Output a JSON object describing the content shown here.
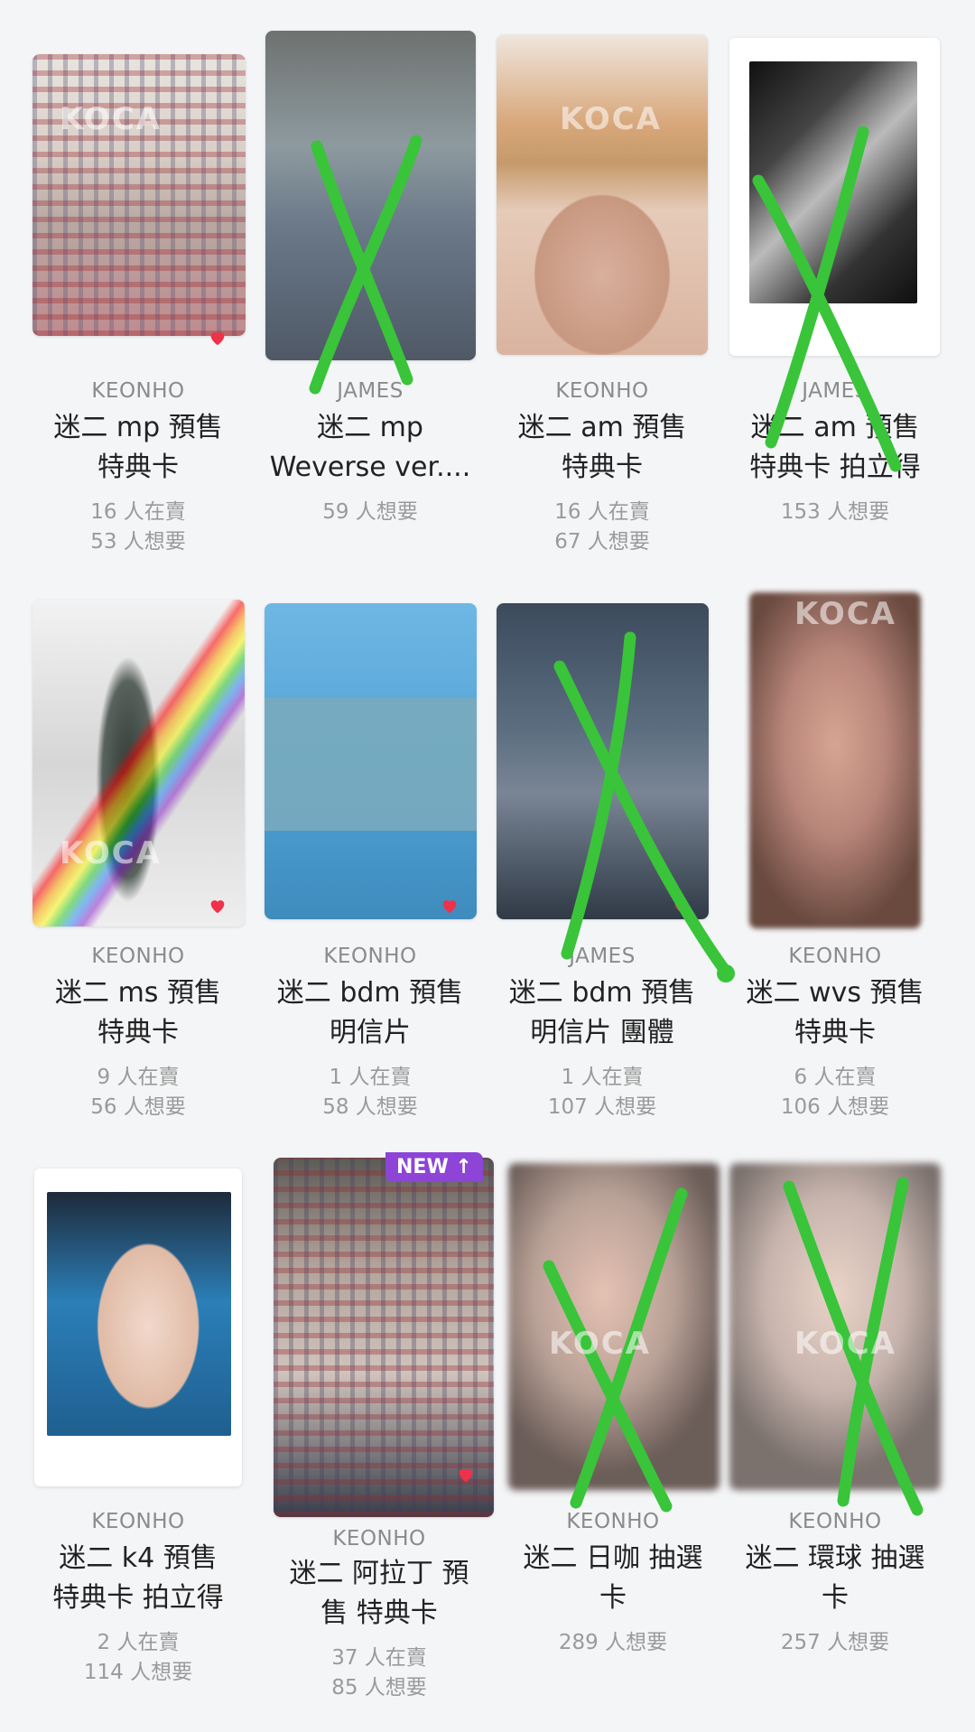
{
  "cards": [
    {
      "name": "KEONHO",
      "title": [
        "迷二 mp 預售",
        "特典卡"
      ],
      "stats": [
        "16 人在賣",
        "53 人想要"
      ],
      "favorited": true,
      "crossed": false
    },
    {
      "name": "JAMES",
      "title": [
        "迷二 mp",
        "Weverse ver...."
      ],
      "stats": [
        "59 人想要"
      ],
      "favorited": false,
      "crossed": true
    },
    {
      "name": "KEONHO",
      "title": [
        "迷二 am 預售",
        "特典卡"
      ],
      "stats": [
        "16 人在賣",
        "67 人想要"
      ],
      "favorited": false,
      "crossed": false
    },
    {
      "name": "JAMES",
      "title": [
        "迷二 am 預售",
        "特典卡 拍立得"
      ],
      "stats": [
        "153 人想要"
      ],
      "favorited": false,
      "crossed": true
    },
    {
      "name": "KEONHO",
      "title": [
        "迷二 ms 預售",
        "特典卡"
      ],
      "stats": [
        "9 人在賣",
        "56 人想要"
      ],
      "favorited": true,
      "crossed": false
    },
    {
      "name": "KEONHO",
      "title": [
        "迷二 bdm 預售",
        "明信片"
      ],
      "stats": [
        "1 人在賣",
        "58 人想要"
      ],
      "favorited": true,
      "crossed": false
    },
    {
      "name": "JAMES",
      "title": [
        "迷二 bdm 預售",
        "明信片 團體"
      ],
      "stats": [
        "1 人在賣",
        "107 人想要"
      ],
      "favorited": true,
      "crossed": true
    },
    {
      "name": "KEONHO",
      "title": [
        "迷二 wvs 預售",
        "特典卡"
      ],
      "stats": [
        "6 人在賣",
        "106 人想要"
      ],
      "favorited": false,
      "crossed": false
    },
    {
      "name": "KEONHO",
      "title": [
        "迷二 k4 預售",
        "特典卡 拍立得"
      ],
      "stats": [
        "2 人在賣",
        "114 人想要"
      ],
      "favorited": false,
      "crossed": false
    },
    {
      "name": "KEONHO",
      "title": [
        "迷二 阿拉丁 預",
        "售 特典卡"
      ],
      "stats": [
        "37 人在賣",
        "85 人想要"
      ],
      "favorited": true,
      "crossed": false,
      "badge": "NEW ↑"
    },
    {
      "name": "KEONHO",
      "title": [
        "迷二 日咖 抽選",
        "卡"
      ],
      "stats": [
        "289 人想要"
      ],
      "favorited": false,
      "crossed": true
    },
    {
      "name": "KEONHO",
      "title": [
        "迷二 環球 抽選",
        "卡"
      ],
      "stats": [
        "257 人想要"
      ],
      "favorited": false,
      "crossed": true
    }
  ],
  "watermark": "KOCA",
  "colors": {
    "heart": "#f0314a",
    "cross": "#39c43a",
    "badge": "#8e44d6"
  }
}
